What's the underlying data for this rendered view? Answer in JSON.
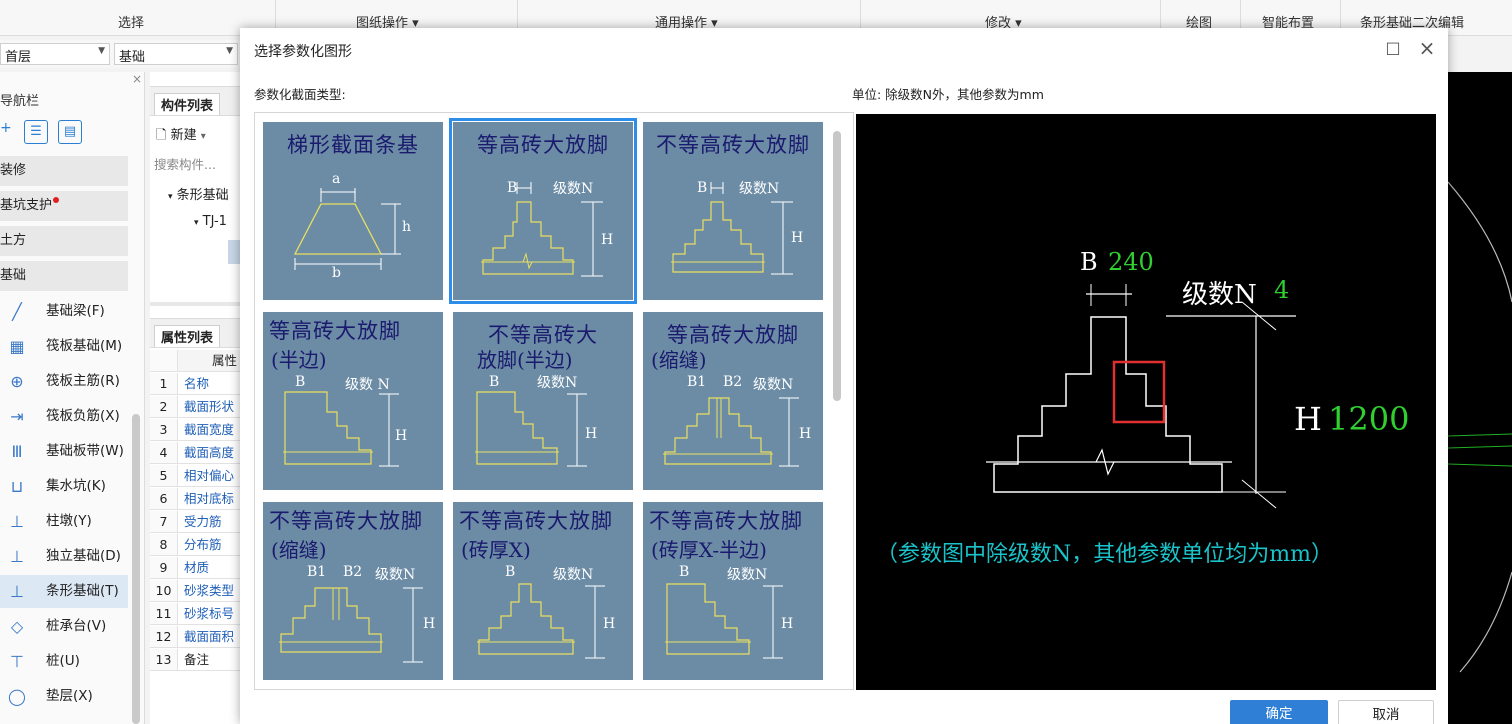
{
  "ribbon": {
    "groups": [
      "选择",
      "图纸操作 ▾",
      "通用操作 ▾",
      "修改 ▾",
      "绘图",
      "智能布置",
      "条形基础二次编辑"
    ]
  },
  "floorbar": {
    "floor": "首层",
    "category": "基础"
  },
  "nav": {
    "title": "导航栏",
    "close": "×",
    "categories": [
      "装修",
      "基坑支护",
      "土方",
      "基础"
    ],
    "items": [
      {
        "icon": "╱",
        "label": "基础梁(F)"
      },
      {
        "icon": "▦",
        "label": "筏板基础(M)"
      },
      {
        "icon": "⊕",
        "label": "筏板主筋(R)"
      },
      {
        "icon": "⇥",
        "label": "筏板负筋(X)"
      },
      {
        "icon": "Ⅲ",
        "label": "基础板带(W)"
      },
      {
        "icon": "⊔",
        "label": "集水坑(K)"
      },
      {
        "icon": "⊥",
        "label": "柱墩(Y)"
      },
      {
        "icon": "⊥",
        "label": "独立基础(D)"
      },
      {
        "icon": "⊥",
        "label": "条形基础(T)"
      },
      {
        "icon": "◇",
        "label": "桩承台(V)"
      },
      {
        "icon": "⊤",
        "label": "桩(U)"
      },
      {
        "icon": "◯",
        "label": "垫层(X)"
      }
    ]
  },
  "component": {
    "tab1": "构件列表",
    "new_btn": "新建",
    "search_placeholder": "搜索构件...",
    "tree_root": "条形基础",
    "tree_child": "TJ-1",
    "tab2": "属性列表",
    "prop_header": "属性",
    "props": [
      {
        "no": "1",
        "name": "名称"
      },
      {
        "no": "2",
        "name": "截面形状"
      },
      {
        "no": "3",
        "name": "截面宽度"
      },
      {
        "no": "4",
        "name": "截面高度"
      },
      {
        "no": "5",
        "name": "相对偏心"
      },
      {
        "no": "6",
        "name": "相对底标"
      },
      {
        "no": "7",
        "name": "受力筋"
      },
      {
        "no": "8",
        "name": "分布筋"
      },
      {
        "no": "9",
        "name": "材质"
      },
      {
        "no": "10",
        "name": "砂浆类型"
      },
      {
        "no": "11",
        "name": "砂浆标号"
      },
      {
        "no": "12",
        "name": "截面面积"
      },
      {
        "no": "13",
        "name": "备注"
      }
    ]
  },
  "dialog": {
    "title": "选择参数化图形",
    "type_label": "参数化截面类型:",
    "unit_label": "单位:  除级数N外，其他参数为mm",
    "tiles": [
      {
        "title": "梯形截面条基",
        "labels": [
          "a",
          "h",
          "b"
        ]
      },
      {
        "title": "等高砖大放脚",
        "labels": [
          "B",
          "级数N",
          "H"
        ]
      },
      {
        "title": "不等高砖大放脚",
        "labels": [
          "B",
          "级数N",
          "H"
        ]
      },
      {
        "title": "等高砖大放脚",
        "subtitle": "(半边)",
        "labels": [
          "B",
          "级数 N",
          "H"
        ]
      },
      {
        "title": "不等高砖大",
        "subtitle": "放脚(半边)",
        "labels": [
          "B",
          "级数N",
          "H"
        ]
      },
      {
        "title": "等高砖大放脚",
        "subtitle": "(缩缝)",
        "labels": [
          "B1",
          "B2",
          "级数N",
          "H"
        ]
      },
      {
        "title": "不等高砖大放脚",
        "subtitle": "(缩缝)",
        "labels": [
          "B1",
          "B2",
          "级数N",
          "H"
        ]
      },
      {
        "title": "不等高砖大放脚",
        "subtitle": "(砖厚X)",
        "labels": [
          "B",
          "级数N",
          "H"
        ]
      },
      {
        "title": "不等高砖大放脚",
        "subtitle": "(砖厚X-半边)",
        "labels": [
          "B",
          "级数N",
          "H"
        ]
      }
    ],
    "selected_index": 1,
    "preview": {
      "b_label": "B",
      "b_value": "240",
      "n_label": "级数N",
      "n_value": "4",
      "h_label": "H",
      "h_value": "1200",
      "note": "（参数图中除级数N，其他参数单位均为mm）"
    },
    "ok": "确定",
    "cancel": "取消",
    "max_icon": "□",
    "close_icon": "×"
  },
  "colors": {
    "tile_bg": "#6c8ca6",
    "tile_title": "#1a1a6e",
    "tile_line": "#e8e060",
    "selected_outline": "#2d8de8",
    "preview_green": "#2fd02f",
    "preview_cyan": "#19c3c9",
    "preview_red": "#e03030",
    "primary": "#2f7fd6"
  }
}
